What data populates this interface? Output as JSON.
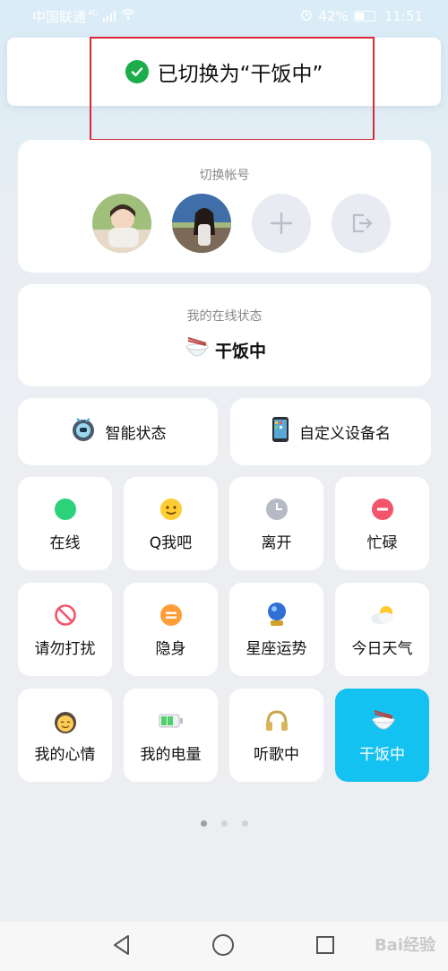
{
  "status_bar": {
    "carrier": "中国联通",
    "network": "4G",
    "battery": "42%",
    "time": "11:51"
  },
  "toast": {
    "message": "已切换为“干饭中”"
  },
  "account": {
    "title": "切换帐号"
  },
  "online_status": {
    "title": "我的在线状态",
    "current": "干饭中"
  },
  "features": {
    "smart": "智能状态",
    "device": "自定义设备名"
  },
  "status_tiles": [
    {
      "label": "在线",
      "icon": "green-dot-icon"
    },
    {
      "label": "Q我吧",
      "icon": "smiley-icon"
    },
    {
      "label": "离开",
      "icon": "clock-icon"
    },
    {
      "label": "忙碌",
      "icon": "minus-icon"
    },
    {
      "label": "请勿打扰",
      "icon": "no-entry-icon"
    },
    {
      "label": "隐身",
      "icon": "invisible-icon"
    },
    {
      "label": "星座运势",
      "icon": "crystal-ball-icon"
    },
    {
      "label": "今日天气",
      "icon": "weather-icon"
    },
    {
      "label": "我的心情",
      "icon": "mood-icon"
    },
    {
      "label": "我的电量",
      "icon": "battery-icon"
    },
    {
      "label": "听歌中",
      "icon": "headphones-icon"
    },
    {
      "label": "干饭中",
      "icon": "rice-bowl-icon",
      "selected": true
    }
  ],
  "colors": {
    "selected": "#13c2f0",
    "check": "#1aad4a",
    "highlight": "#d62b35"
  },
  "watermark": "Bai经验"
}
